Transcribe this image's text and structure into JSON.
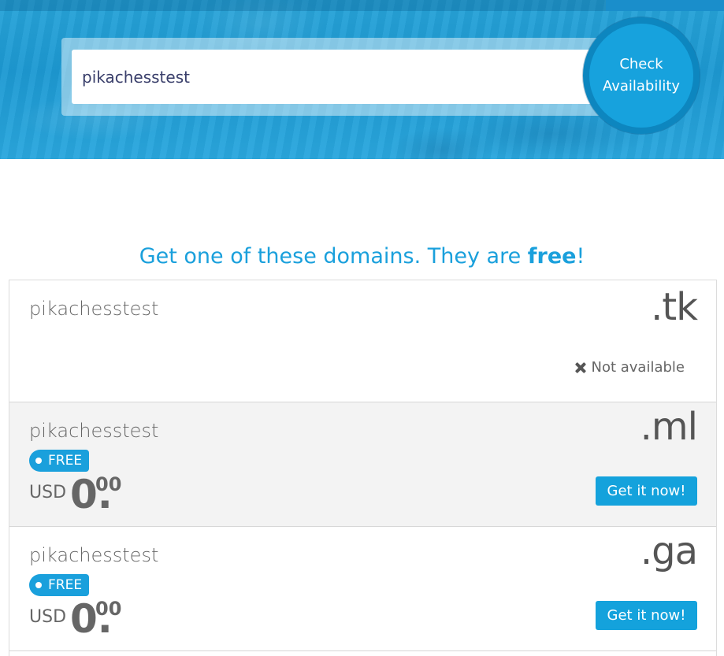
{
  "search": {
    "value": "pikachesstest",
    "button_label_line1": "Check",
    "button_label_line2": "Availability"
  },
  "heading": {
    "prefix": "Get one of these domains. They are ",
    "emphasis": "free",
    "suffix": "!"
  },
  "domains": [
    {
      "name": "pikachesstest",
      "tld": ".tk",
      "status_text": "Not available",
      "status_icon": "close-icon"
    },
    {
      "name": "pikachesstest",
      "tld": ".ml",
      "badge": "FREE",
      "currency": "USD",
      "price_whole": "0.",
      "price_decimal": "00",
      "button": "Get it now!"
    },
    {
      "name": "pikachesstest",
      "tld": ".ga",
      "badge": "FREE",
      "currency": "USD",
      "price_whole": "0.",
      "price_decimal": "00",
      "button": "Get it now!"
    }
  ],
  "colors": {
    "accent": "#1aa0dc",
    "button_ring": "#0d86bf",
    "alt_row": "#f3f3f3",
    "text": "#555555"
  }
}
